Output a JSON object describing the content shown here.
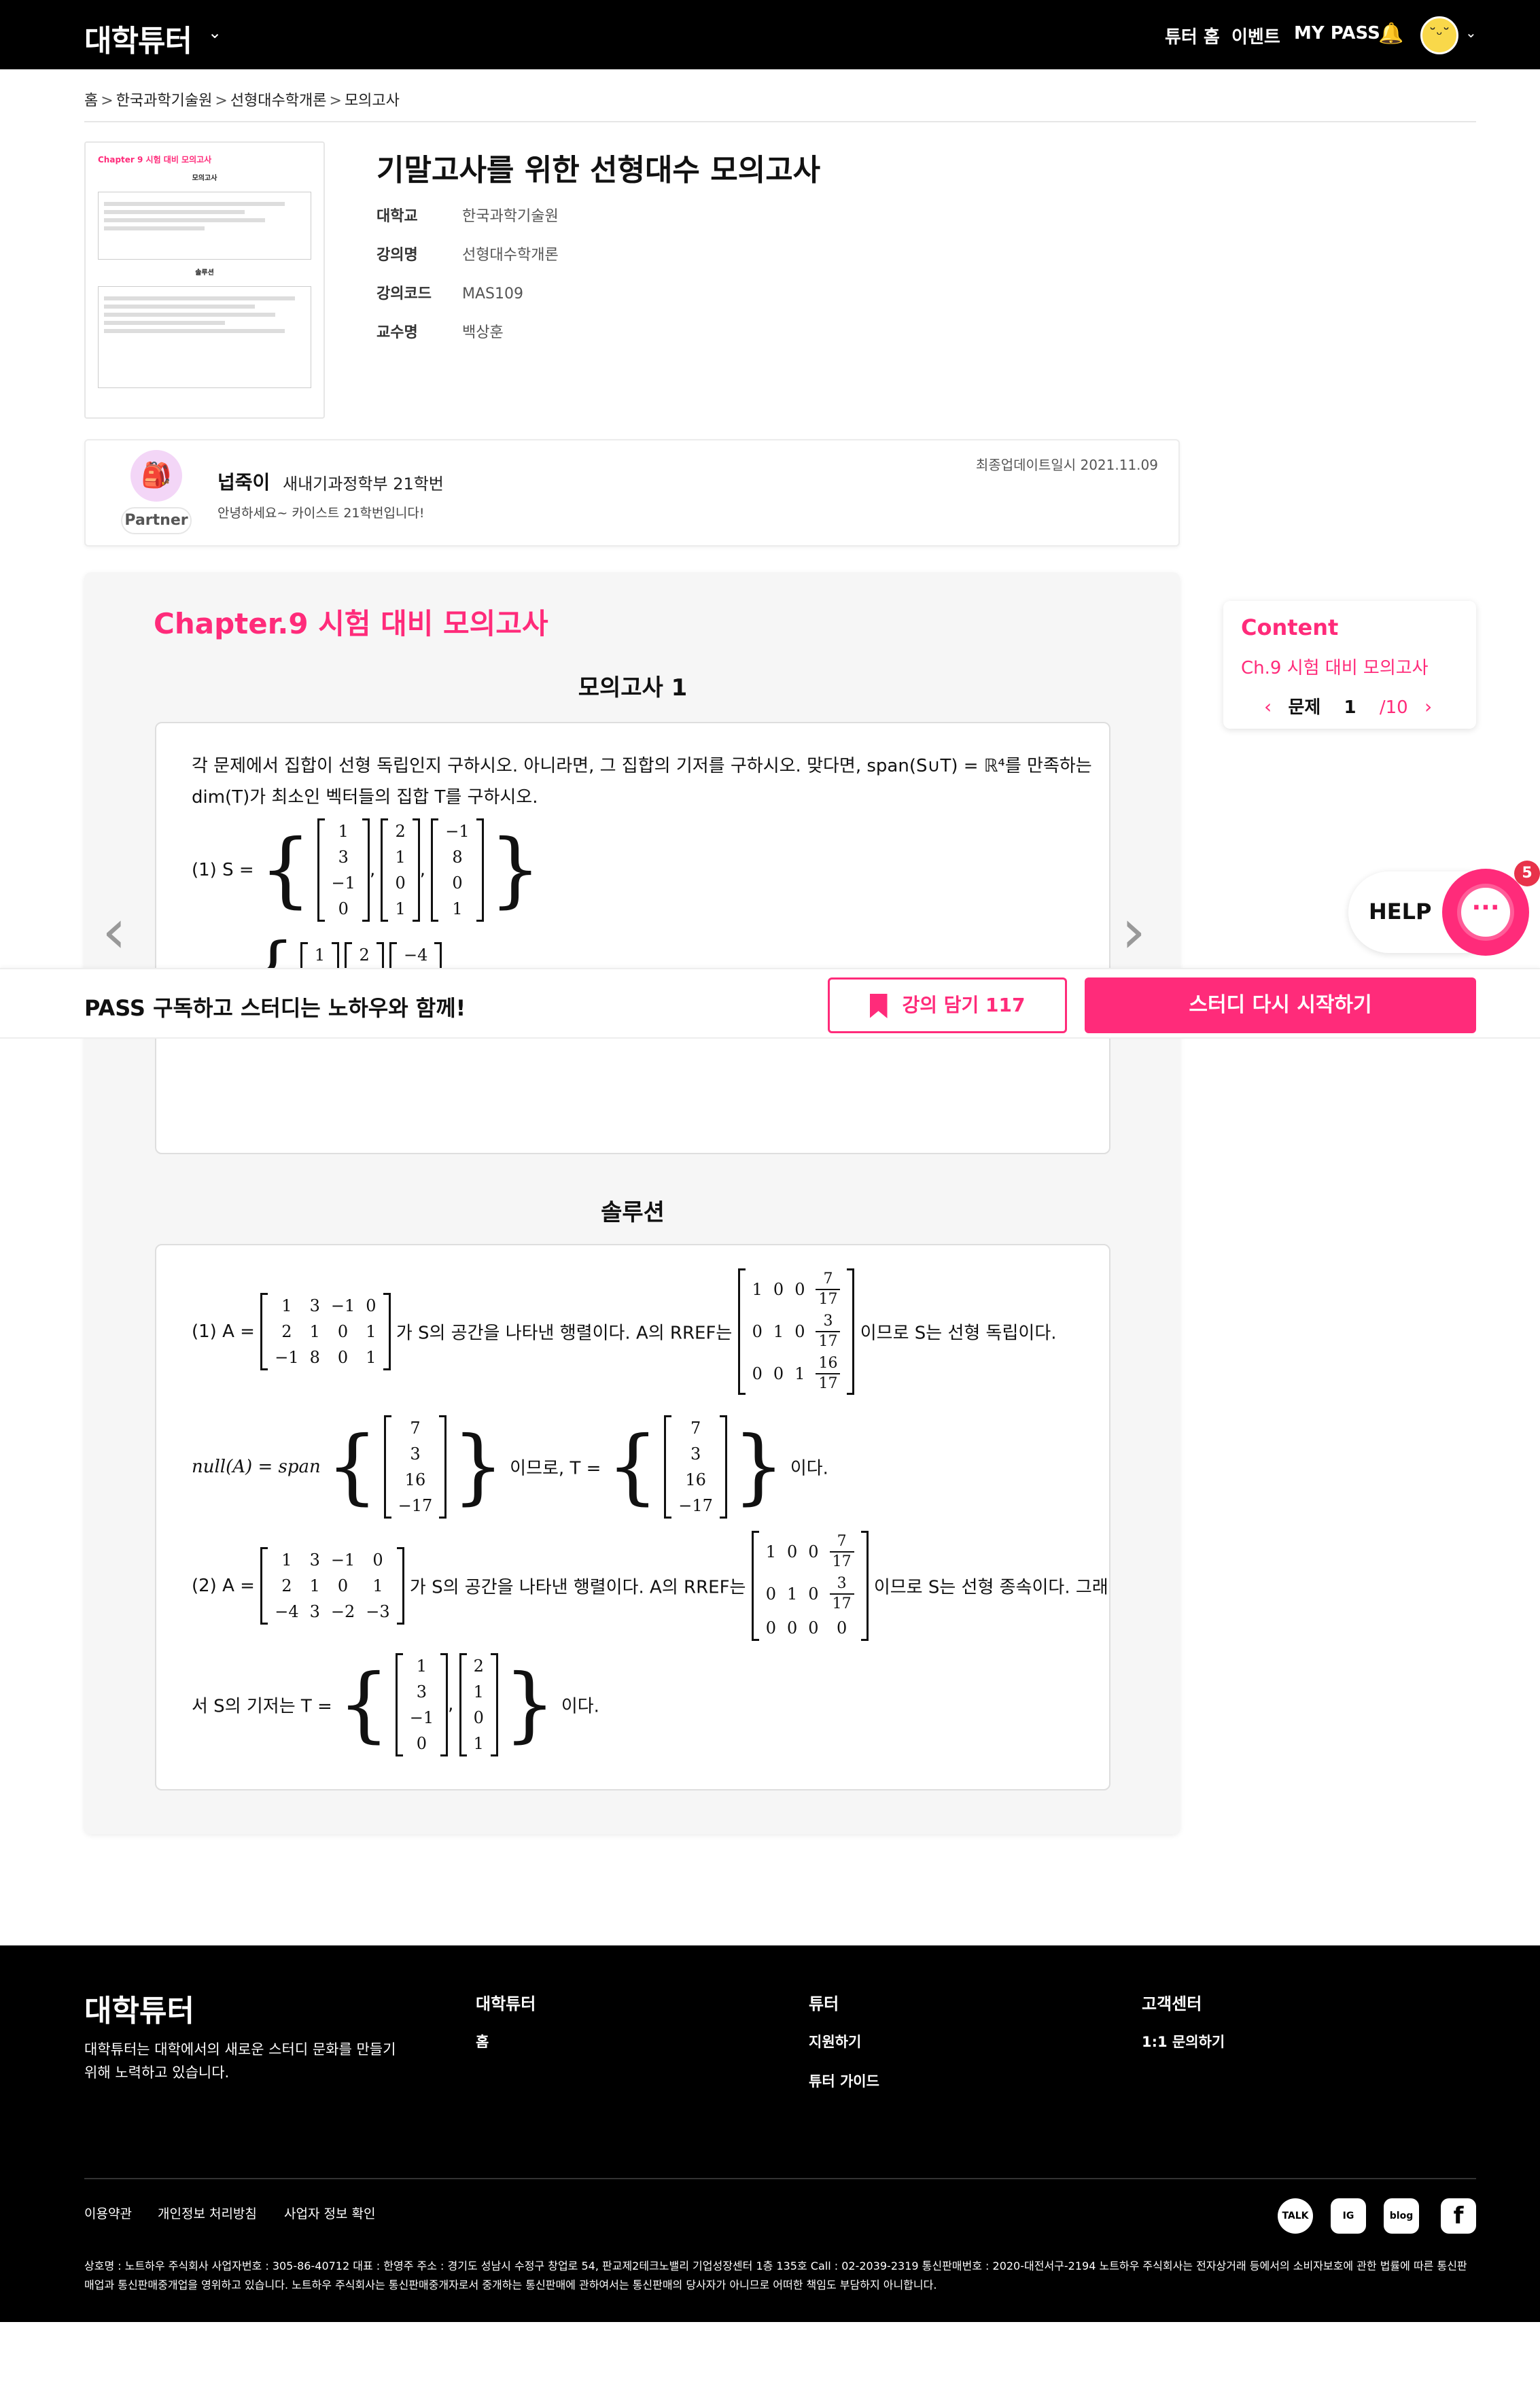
{
  "header": {
    "logo": "대학튜터",
    "nav": [
      "튜터 홈",
      "이벤트",
      "MY PASS"
    ]
  },
  "breadcrumb": [
    "홈",
    "한국과학기술원",
    "선형대수학개론",
    "모의고사"
  ],
  "course": {
    "title": "기말고사를 위한 선형대수 모의고사",
    "fields": [
      {
        "label": "대학교",
        "value": "한국과학기술원"
      },
      {
        "label": "강의명",
        "value": "선형대수학개론"
      },
      {
        "label": "강의코드",
        "value": "MAS109"
      },
      {
        "label": "교수명",
        "value": "백상훈"
      }
    ],
    "thumb_title": "Chapter 9 시험 대비 모의고사",
    "thumb_sub1": "모의고사",
    "thumb_sub2": "솔루션"
  },
  "partner": {
    "name": "넙죽이",
    "dept": "새내기과정학부 21학번",
    "greeting": "안녕하세요~ 카이스트 21학번입니다!",
    "badge": "Partner",
    "updated": "최종업데이트일시 2021.11.09"
  },
  "content": {
    "chapter_title": "Chapter.9 시험 대비 모의고사",
    "problem_heading": "모의고사 1",
    "problem_text_1": "각 문제에서 집합이 선형 독립인지 구하시오. 아니라면, 그 집합의 기저를 구하시오. 맞다면, span(S∪T) = ℝ⁴를 만족하는",
    "problem_text_2": "dim(T)가 최소인 벡터들의 집합 T를 구하시오.",
    "problem_label": "(1) S =",
    "solution_heading": "솔루션",
    "sol1_prefix": "(1) A =",
    "sol1_mid": "가 S의 공간을 나타낸 행렬이다. A의 RREF는",
    "sol1_suffix": "이므로 S는 선형 독립이다.",
    "null_prefix": "null(A) = span",
    "null_mid": "이므로, T =",
    "null_suffix": "이다.",
    "sol2_prefix": "(2) A =",
    "sol2_mid": "가 S의 공간을 나타낸 행렬이다. A의 RREF는",
    "sol2_suffix": "이므로 S는 선형 종속이다. 그래",
    "sol2_line2_prefix": "서 S의 기저는 T =",
    "sol2_line2_suffix": "이다."
  },
  "side": {
    "title": "Content",
    "chapter": "Ch.9 시험 대비 모의고사",
    "problem_label": "문제",
    "current": "1",
    "total": "/10"
  },
  "help": {
    "label": "HELP",
    "badge": "5"
  },
  "sticky": {
    "text": "PASS 구독하고 스터디는 노하우와 함께!",
    "bookmark": "강의 담기 117",
    "restart": "스터디 다시 시작하기"
  },
  "footer": {
    "logo": "대학튜터",
    "desc": "대학튜터는 대학에서의 새로운 스터디 문화를 만들기 위해 노력하고 있습니다.",
    "col1_title": "대학튜터",
    "col1_links": [
      "홈"
    ],
    "col2_title": "튜터",
    "col2_links": [
      "지원하기",
      "튜터 가이드"
    ],
    "col3_title": "고객센터",
    "col3_links": [
      "1:1 문의하기"
    ],
    "bottom_links": [
      "이용약관",
      "개인정보 처리방침",
      "사업자 정보 확인"
    ],
    "social": [
      "TALK",
      "IG",
      "blog",
      "f"
    ],
    "legal": "상호명 : 노트하우 주식회사 사업자번호 : 305-86-40712 대표 : 한영주 주소 : 경기도 성남시 수정구 창업로 54, 판교제2테크노밸리 기업성장센터 1층 135호 Call : 02-2039-2319 통신판매번호 : 2020-대전서구-2194 노트하우 주식회사는 전자상거래 등에서의 소비자보호에 관한 법률에 따른 통신판매업과 통신판매중개업을 영위하고 있습니다. 노트하우 주식회사는 통신판매중개자로서 중개하는 통신판매에 관하여서는 통신판매의 당사자가 아니므로 어떠한 책임도 부담하지 아니합니다."
  },
  "matrices": {
    "problem_v1": [
      "1",
      "3",
      "−1",
      "0"
    ],
    "problem_v2": [
      "2",
      "1",
      "0",
      "1"
    ],
    "problem_v3": [
      "−1",
      "8",
      "0",
      "1"
    ],
    "sol1_A": [
      [
        "1",
        "3",
        "−1",
        "0"
      ],
      [
        "2",
        "1",
        "0",
        "1"
      ],
      [
        "−1",
        "8",
        "0",
        "1"
      ]
    ],
    "null_v": [
      "7",
      "3",
      "16",
      "−17"
    ],
    "sol2_A": [
      [
        "1",
        "3",
        "−1",
        "0"
      ],
      [
        "2",
        "1",
        "0",
        "1"
      ],
      [
        "−4",
        "3",
        "−2",
        "−3"
      ]
    ],
    "basis_v1": [
      "1",
      "3",
      "−1",
      "0"
    ],
    "basis_v2": [
      "2",
      "1",
      "0",
      "1"
    ]
  }
}
